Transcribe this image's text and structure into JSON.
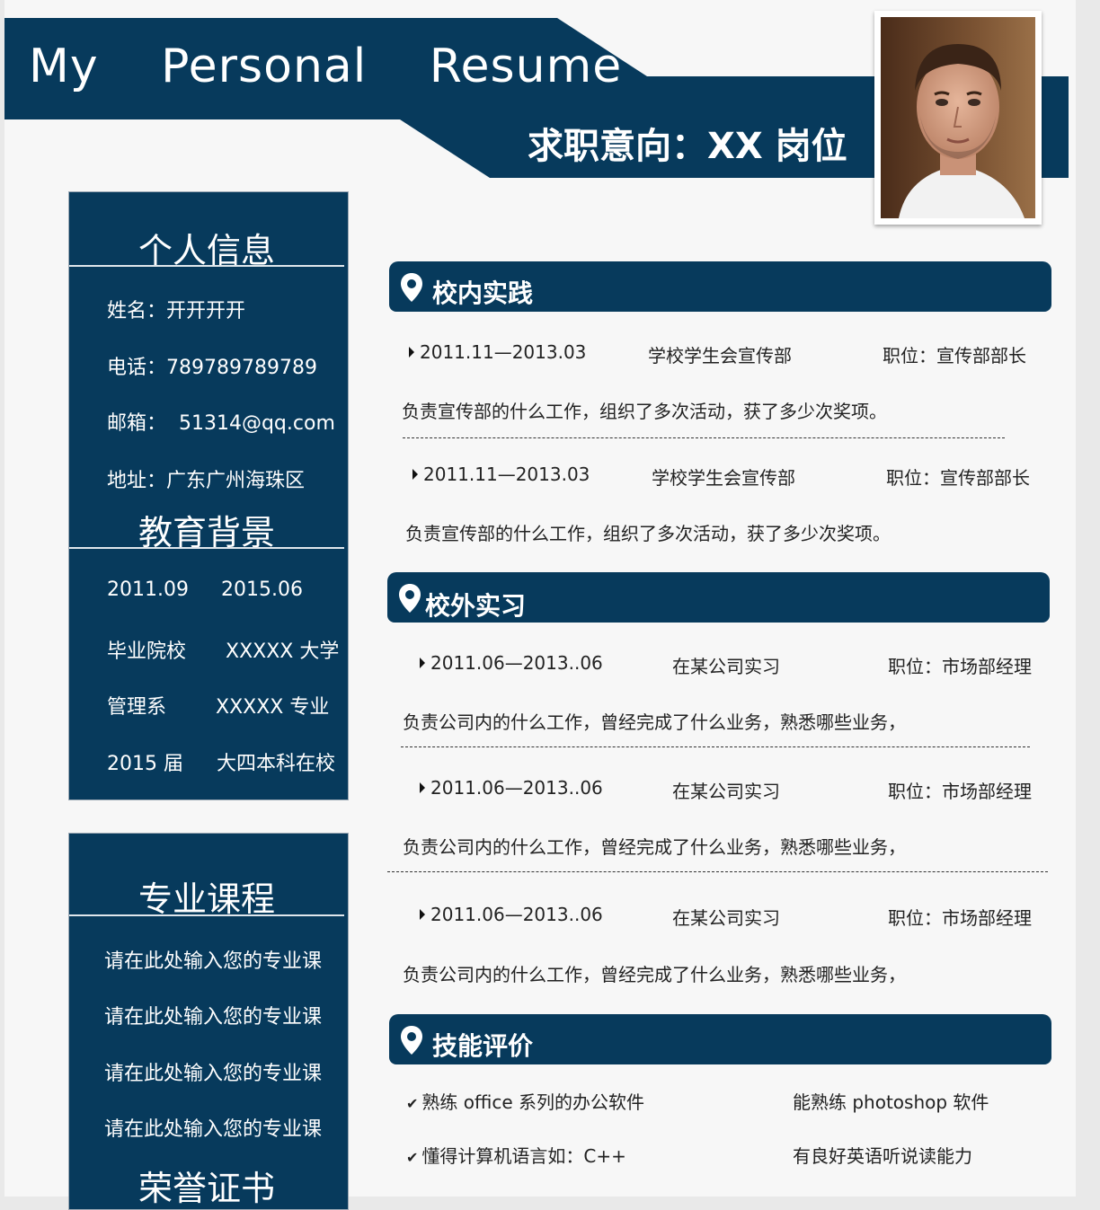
{
  "header": {
    "title_words": [
      "My",
      "Personal",
      "Resume"
    ],
    "intent": "求职意向：XX 岗位"
  },
  "personal": {
    "heading": "个人信息",
    "name": "姓名：开开开开",
    "phone": "电话：789789789789",
    "email": "邮箱：  51314@qq.com",
    "address": "地址：广东广州海珠区"
  },
  "education": {
    "heading": "教育背景",
    "rows": [
      {
        "left": "2011.09",
        "right": "2015.06"
      },
      {
        "left": "毕业院校",
        "right": "XXXXX 大学"
      },
      {
        "left": "管理系",
        "right": "XXXXX 专业"
      },
      {
        "left": "2015 届",
        "right": "大四本科在校"
      }
    ]
  },
  "courses": {
    "heading": "专业课程",
    "items": [
      "请在此处输入您的专业课",
      "请在此处输入您的专业课",
      "请在此处输入您的专业课",
      "请在此处输入您的专业课"
    ]
  },
  "honors": {
    "heading": "荣誉证书"
  },
  "campus": {
    "heading": "校内实践",
    "entries": [
      {
        "date": "2011.11—2013.03",
        "org": "学校学生会宣传部",
        "position": "职位：宣传部部长",
        "desc": "负责宣传部的什么工作，组织了多次活动，获了多少次奖项。"
      },
      {
        "date": "2011.11—2013.03",
        "org": "学校学生会宣传部",
        "position": "职位：宣传部部长",
        "desc": "负责宣传部的什么工作，组织了多次活动，获了多少次奖项。"
      }
    ]
  },
  "intern": {
    "heading": "校外实习",
    "entries": [
      {
        "date": "2011.06—2013..06",
        "org": "在某公司实习",
        "position": "职位：市场部经理",
        "desc": "负责公司内的什么工作，曾经完成了什么业务，熟悉哪些业务，"
      },
      {
        "date": "2011.06—2013..06",
        "org": "在某公司实习",
        "position": "职位：市场部经理",
        "desc": "负责公司内的什么工作，曾经完成了什么业务，熟悉哪些业务，"
      },
      {
        "date": "2011.06—2013..06",
        "org": "在某公司实习",
        "position": "职位：市场部经理",
        "desc": "负责公司内的什么工作，曾经完成了什么业务，熟悉哪些业务，"
      }
    ]
  },
  "skills": {
    "heading": "技能评价",
    "items": [
      "熟练 office 系列的办公软件",
      "能熟练 photoshop 软件",
      "懂得计算机语言如：C++",
      "有良好英语听说读能力"
    ]
  },
  "colors": {
    "navy": "#073a5c",
    "page": "#f7f7f7"
  }
}
